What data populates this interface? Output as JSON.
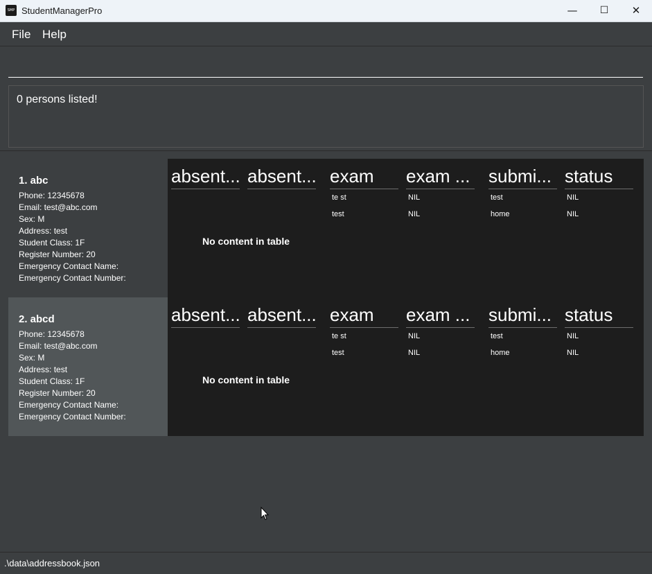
{
  "window": {
    "title": "StudentManagerPro",
    "icon_text": "SMP"
  },
  "menu": {
    "file": "File",
    "help": "Help"
  },
  "command": {
    "value": ""
  },
  "result": {
    "text": "0 persons listed!"
  },
  "table_headers": [
    "absent...",
    "absent...",
    "exam",
    "exam ...",
    "submi...",
    "status"
  ],
  "persons": [
    {
      "name": "1. abc",
      "phone": "Phone: 12345678",
      "email": "Email: test@abc.com",
      "sex": "Sex: M",
      "address": "Address: test",
      "student_class": "Student Class: 1F",
      "register_number": "Register Number: 20",
      "emergency_name": "Emergency Contact Name:",
      "emergency_number": "Emergency Contact Number:",
      "exams": [
        {
          "exam": "te st",
          "score": "NIL"
        },
        {
          "exam": "test",
          "score": "NIL"
        }
      ],
      "submissions": [
        {
          "submission": "test",
          "status": "NIL"
        },
        {
          "submission": "home",
          "status": "NIL"
        }
      ],
      "absence_placeholder": "No content in table"
    },
    {
      "name": "2. abcd",
      "phone": "Phone: 12345678",
      "email": "Email: test@abc.com",
      "sex": "Sex: M",
      "address": "Address: test",
      "student_class": "Student Class: 1F",
      "register_number": "Register Number: 20",
      "emergency_name": "Emergency Contact Name:",
      "emergency_number": "Emergency Contact Number:",
      "exams": [
        {
          "exam": "te st",
          "score": "NIL"
        },
        {
          "exam": "test",
          "score": "NIL"
        }
      ],
      "submissions": [
        {
          "submission": "test",
          "status": "NIL"
        },
        {
          "submission": "home",
          "status": "NIL"
        }
      ],
      "absence_placeholder": "No content in table"
    }
  ],
  "footer": {
    "path": ".\\data\\addressbook.json"
  }
}
